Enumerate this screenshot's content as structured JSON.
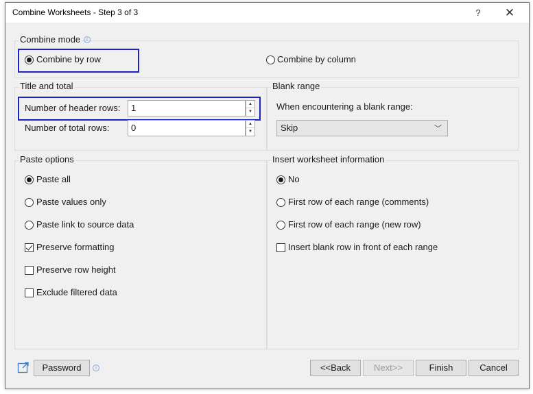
{
  "window": {
    "title": "Combine Worksheets - Step 3 of 3",
    "help_glyph": "?",
    "close_glyph": "✕"
  },
  "combine_mode": {
    "label": "Combine mode",
    "options": [
      {
        "label": "Combine by row",
        "selected": true
      },
      {
        "label": "Combine by column",
        "selected": false
      }
    ]
  },
  "title_total": {
    "label": "Title and total",
    "header_rows_label": "Number of header rows:",
    "header_rows_value": "1",
    "total_rows_label": "Number of total rows:",
    "total_rows_value": "0"
  },
  "blank_range": {
    "label": "Blank range",
    "prompt": "When encountering a blank range:",
    "selected": "Skip"
  },
  "paste_options": {
    "label": "Paste options",
    "radios": [
      {
        "label": "Paste all",
        "selected": true
      },
      {
        "label": "Paste values only",
        "selected": false
      },
      {
        "label": "Paste link to source data",
        "selected": false
      }
    ],
    "checks": [
      {
        "label": "Preserve formatting",
        "checked": true
      },
      {
        "label": "Preserve row height",
        "checked": false
      },
      {
        "label": "Exclude filtered data",
        "checked": false
      }
    ]
  },
  "insert_info": {
    "label": "Insert worksheet information",
    "radios": [
      {
        "label": "No",
        "selected": true
      },
      {
        "label": "First row of each range (comments)",
        "selected": false
      },
      {
        "label": "First row of each range (new row)",
        "selected": false
      }
    ],
    "checks": [
      {
        "label": "Insert blank row in front of each range",
        "checked": false
      }
    ]
  },
  "footer": {
    "password": "Password",
    "back": "<<Back",
    "next": "Next>>",
    "finish": "Finish",
    "cancel": "Cancel"
  },
  "colors": {
    "highlight": "#1c22c4",
    "window_border": "#2b7bd8",
    "dialog_bg": "#f0f0f0"
  },
  "icons": {
    "info": "info-icon",
    "external": "external-link-icon"
  }
}
